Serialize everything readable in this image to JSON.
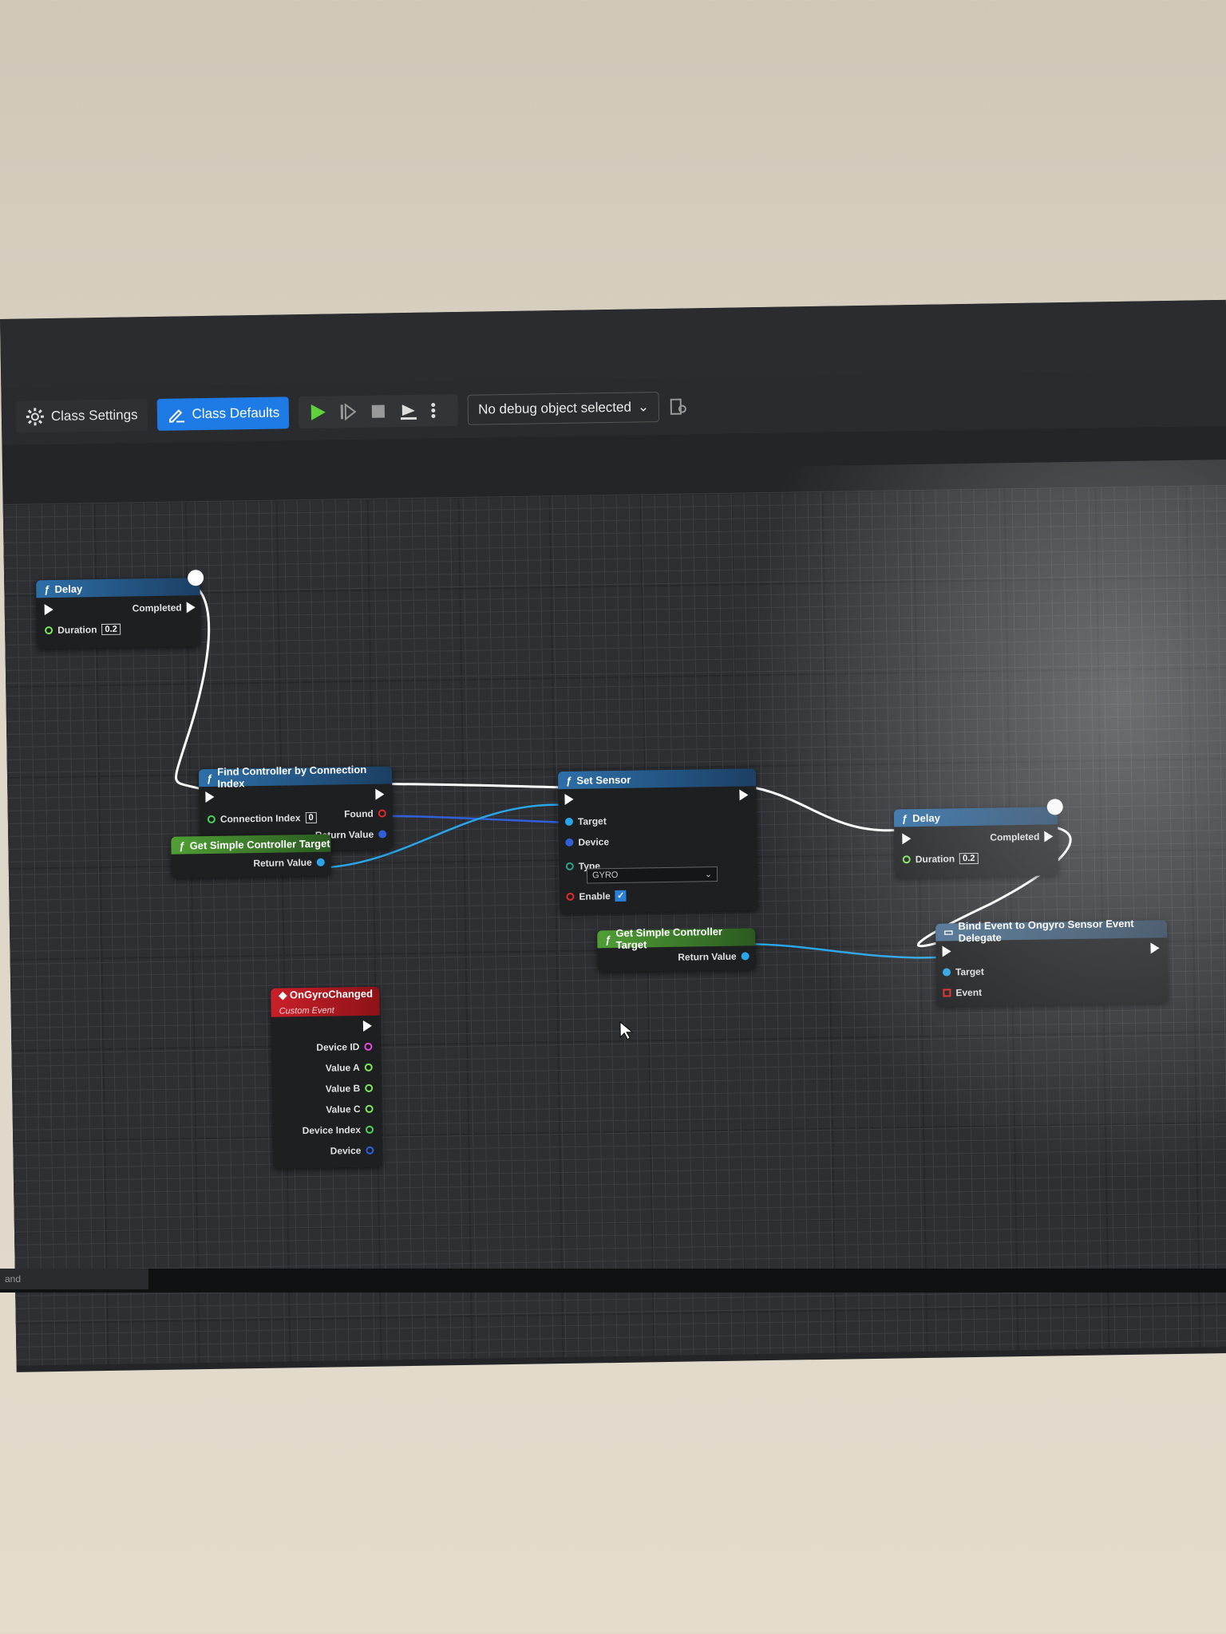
{
  "toolbar": {
    "class_settings": "Class Settings",
    "class_defaults": "Class Defaults",
    "debug_select": "No debug object selected"
  },
  "nodes": {
    "delay1": {
      "title": "Delay",
      "completed": "Completed",
      "duration_label": "Duration",
      "duration_value": "0.2"
    },
    "find_controller": {
      "title": "Find Controller by Connection Index",
      "connection_index": "Connection Index",
      "connection_index_value": "0",
      "found": "Found",
      "return_value": "Return Value"
    },
    "get_target1": {
      "title": "Get Simple Controller Target",
      "return_value": "Return Value"
    },
    "set_sensor": {
      "title": "Set Sensor",
      "target": "Target",
      "device": "Device",
      "type": "Type",
      "type_value": "GYRO",
      "enable": "Enable"
    },
    "delay2": {
      "title": "Delay",
      "completed": "Completed",
      "duration_label": "Duration",
      "duration_value": "0.2"
    },
    "get_target2": {
      "title": "Get Simple Controller Target",
      "return_value": "Return Value"
    },
    "bind_event": {
      "title": "Bind Event to Ongyro Sensor Event Delegate",
      "target": "Target",
      "event": "Event"
    },
    "on_gyro": {
      "title": "OnGyroChanged",
      "subtitle": "Custom Event",
      "pins": [
        "Device ID",
        "Value A",
        "Value B",
        "Value C",
        "Device Index",
        "Device"
      ]
    }
  },
  "statusbar": {
    "text": "and"
  },
  "colors": {
    "accent": "#1e7be6",
    "exec": "#ffffff",
    "object_pin": "#2aa5e8",
    "bool_pin": "#e02a2a",
    "int_pin": "#4ad25a",
    "float_pin": "#7de65a",
    "device_id_pin": "#e14ce0"
  }
}
